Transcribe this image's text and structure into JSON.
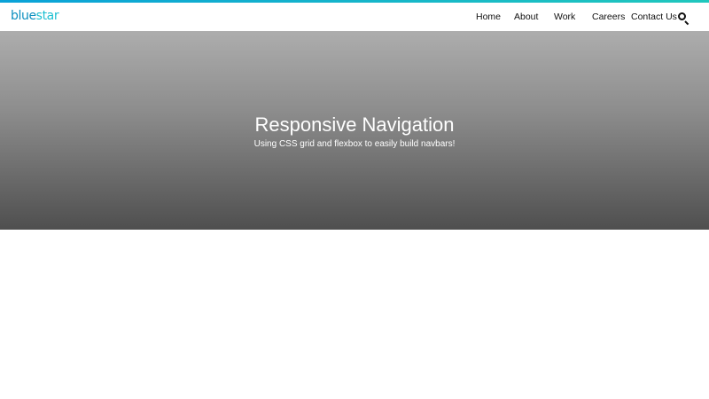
{
  "brand": {
    "logo_main": "blue",
    "logo_accent": "star"
  },
  "navigation": {
    "items": [
      {
        "label": "Home"
      },
      {
        "label": "About"
      },
      {
        "label": "Work"
      },
      {
        "label": "Careers"
      },
      {
        "label": "Contact Us"
      }
    ],
    "search_icon": "search-icon"
  },
  "hero": {
    "title": "Responsive Navigation",
    "subtitle": "Using CSS grid and flexbox to easily build navbars!"
  },
  "colors": {
    "accent_start": "#0aa2d8",
    "accent_end": "#20c7bd",
    "logo_blue": "#0c8fbf",
    "logo_cyan": "#1fc0d2",
    "hero_top": "#adadad",
    "hero_bottom": "#4f4f4f",
    "nav_text": "#111111",
    "hero_text": "#ffffff"
  }
}
